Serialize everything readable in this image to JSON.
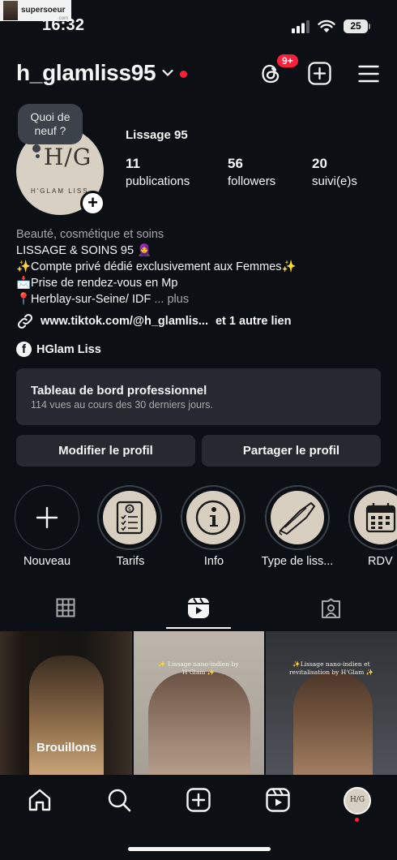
{
  "watermark": {
    "text": "supersoeur",
    "sub": ".com"
  },
  "status_bar": {
    "time": "16:32",
    "battery": "25"
  },
  "header": {
    "username": "h_glamliss95",
    "notifications_badge": "9+"
  },
  "profile": {
    "note_bubble": "Quoi de neuf ?",
    "avatar_monogram": "H/G",
    "avatar_subtext": "H'GLAM LISS",
    "display_name": "Lissage 95",
    "stats": [
      {
        "value": "11",
        "label": "publications"
      },
      {
        "value": "56",
        "label": "followers"
      },
      {
        "value": "20",
        "label": "suivi(e)s"
      }
    ],
    "category": "Beauté, cosmétique et soins",
    "bio_lines": [
      "LISSAGE & SOINS 95 🧕",
      "✨Compte privé dédié exclusivement aux Femmes✨",
      "📩Prise de rendez-vous en Mp",
      "📍Herblay-sur-Seine/ IDF"
    ],
    "more_label": "... plus",
    "link_text": "www.tiktok.com/@h_glamlis...",
    "link_extra": "et 1 autre lien",
    "facebook_name": "HGlam Liss"
  },
  "dashboard": {
    "title": "Tableau de bord professionnel",
    "subtitle": "114 vues au cours des 30 derniers jours."
  },
  "buttons": {
    "edit": "Modifier le profil",
    "share": "Partager le profil"
  },
  "highlights": [
    {
      "label": "Nouveau",
      "icon": "plus-icon"
    },
    {
      "label": "Tarifs",
      "icon": "price-list-icon"
    },
    {
      "label": "Info",
      "icon": "info-icon"
    },
    {
      "label": "Type de liss...",
      "icon": "hair-straightener-icon"
    },
    {
      "label": "RDV",
      "icon": "calendar-icon"
    }
  ],
  "tabs": [
    {
      "name": "grid",
      "icon": "grid-icon",
      "active": false
    },
    {
      "name": "reels",
      "icon": "reels-icon",
      "active": true
    },
    {
      "name": "tagged",
      "icon": "tagged-icon",
      "active": false
    }
  ],
  "posts": [
    {
      "label": "Brouillons"
    },
    {
      "caption": "✨ Lissage nano-indien by H'Glam ✨"
    },
    {
      "caption": "✨Lissage nano-indien et revitalisation by H'Glam ✨"
    }
  ],
  "bottom_nav": [
    "home-icon",
    "search-icon",
    "create-icon",
    "reels-icon",
    "profile-avatar"
  ],
  "colors": {
    "background": "#0c1014",
    "surface": "#262a30",
    "accent_red": "#ff1e3c",
    "muted_text": "#a8a8a8"
  }
}
